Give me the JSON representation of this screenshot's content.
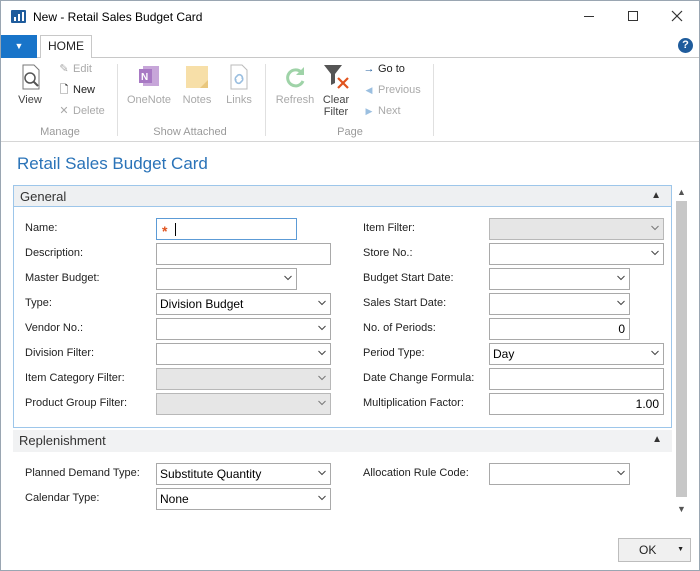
{
  "window": {
    "title": "New - Retail Sales Budget Card"
  },
  "ribbon": {
    "home_tab": "HOME",
    "manage": {
      "view": "View",
      "edit": "Edit",
      "new": "New",
      "delete": "Delete",
      "label": "Manage"
    },
    "attached": {
      "onenote": "OneNote",
      "notes": "Notes",
      "links": "Links",
      "label": "Show Attached"
    },
    "page": {
      "refresh": "Refresh",
      "clear_filter_1": "Clear",
      "clear_filter_2": "Filter",
      "goto": "Go to",
      "previous": "Previous",
      "next": "Next",
      "label": "Page"
    }
  },
  "page_title": "Retail Sales Budget Card",
  "general": {
    "header": "General",
    "fields_left": {
      "name": {
        "label": "Name:",
        "value": ""
      },
      "description": {
        "label": "Description:",
        "value": ""
      },
      "master_budget": {
        "label": "Master Budget:",
        "value": ""
      },
      "type": {
        "label": "Type:",
        "value": "Division Budget"
      },
      "vendor_no": {
        "label": "Vendor No.:",
        "value": ""
      },
      "division_filter": {
        "label": "Division Filter:",
        "value": ""
      },
      "item_category_filter": {
        "label": "Item Category Filter:",
        "value": ""
      },
      "product_group_filter": {
        "label": "Product Group Filter:",
        "value": ""
      }
    },
    "fields_right": {
      "item_filter": {
        "label": "Item Filter:",
        "value": ""
      },
      "store_no": {
        "label": "Store No.:",
        "value": ""
      },
      "budget_start_date": {
        "label": "Budget Start Date:",
        "value": ""
      },
      "sales_start_date": {
        "label": "Sales Start Date:",
        "value": ""
      },
      "no_of_periods": {
        "label": "No. of Periods:",
        "value": "0"
      },
      "period_type": {
        "label": "Period Type:",
        "value": "Day"
      },
      "date_change_formula": {
        "label": "Date Change Formula:",
        "value": ""
      },
      "multiplication_factor": {
        "label": "Multiplication Factor:",
        "value": "1.00"
      }
    }
  },
  "replenishment": {
    "header": "Replenishment",
    "planned_demand_type": {
      "label": "Planned Demand Type:",
      "value": "Substitute Quantity"
    },
    "calendar_type": {
      "label": "Calendar Type:",
      "value": "None"
    },
    "allocation_rule_code": {
      "label": "Allocation Rule Code:",
      "value": ""
    }
  },
  "footer": {
    "ok": "OK"
  },
  "colors": {
    "accent": "#2a73b8",
    "file_tab": "#1874c9",
    "required": "#e0531e",
    "fasttab_border": "#9dc6ea"
  }
}
